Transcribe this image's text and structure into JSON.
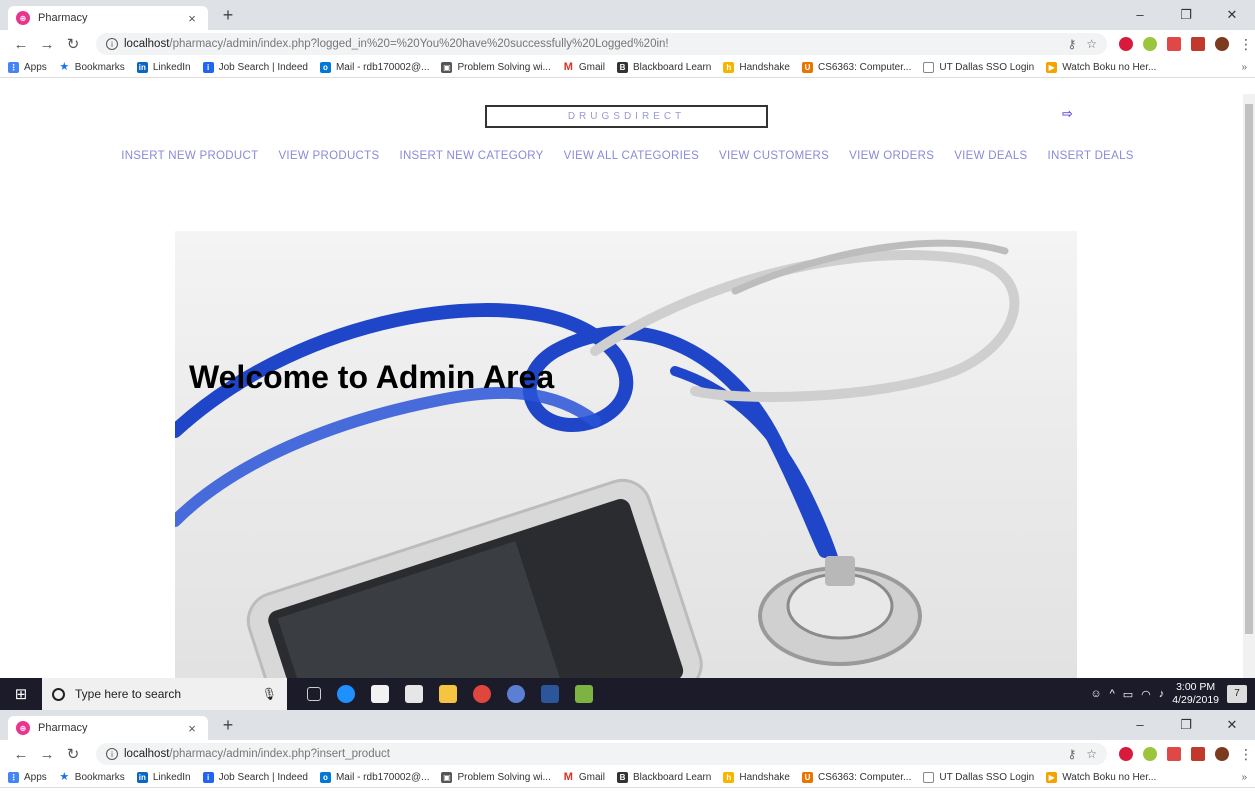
{
  "window1": {
    "tab_title": "Pharmacy",
    "url_host": "localhost",
    "url_path": "/pharmacy/admin/index.php?logged_in%20=%20You%20have%20successfully%20Logged%20in!"
  },
  "window2": {
    "tab_title": "Pharmacy",
    "url_host": "localhost",
    "url_path": "/pharmacy/admin/index.php?insert_product"
  },
  "bookmarks": [
    {
      "label": "Apps",
      "color": "#4285f4"
    },
    {
      "label": "Bookmarks",
      "color": "#1a73e8"
    },
    {
      "label": "LinkedIn",
      "color": "#0a66c2"
    },
    {
      "label": "Job Search | Indeed",
      "color": "#2164f3"
    },
    {
      "label": "Mail - rdb170002@...",
      "color": "#0078d4"
    },
    {
      "label": "Problem Solving wi...",
      "color": "#555555"
    },
    {
      "label": "Gmail",
      "color": "#d93025"
    },
    {
      "label": "Blackboard Learn",
      "color": "#333333"
    },
    {
      "label": "Handshake",
      "color": "#f7b500"
    },
    {
      "label": "CS6363: Computer...",
      "color": "#e87500"
    },
    {
      "label": "UT Dallas SSO Login",
      "color": "#888888"
    },
    {
      "label": "Watch Boku no Her...",
      "color": "#f4a300"
    }
  ],
  "site": {
    "brand": "DRUGSDIRECT",
    "nav": [
      "INSERT NEW PRODUCT",
      "VIEW PRODUCTS",
      "INSERT NEW CATEGORY",
      "VIEW ALL CATEGORIES",
      "VIEW CUSTOMERS",
      "VIEW ORDERS",
      "VIEW DEALS",
      "INSERT DEALS"
    ],
    "hero_title": "Welcome to Admin Area"
  },
  "taskbar": {
    "search_placeholder": "Type here to search",
    "time": "3:00 PM",
    "date": "4/29/2019",
    "notifications": "7"
  }
}
